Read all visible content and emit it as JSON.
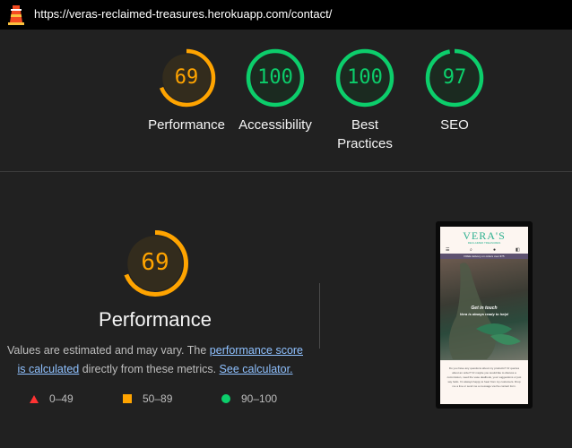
{
  "browser": {
    "url": "https://veras-reclaimed-treasures.herokuapp.com/contact/"
  },
  "summary": {
    "scores": [
      {
        "value": "69",
        "score": 69,
        "label_lines": [
          "Performance"
        ],
        "rating": "average"
      },
      {
        "value": "100",
        "score": 100,
        "label_lines": [
          "Accessibility"
        ],
        "rating": "pass"
      },
      {
        "value": "100",
        "score": 100,
        "label_lines": [
          "Best",
          "Practices"
        ],
        "rating": "pass"
      },
      {
        "value": "97",
        "score": 97,
        "label_lines": [
          "SEO"
        ],
        "rating": "pass"
      }
    ]
  },
  "performance": {
    "value": "69",
    "score": 69,
    "title": "Performance",
    "desc_part1": "Values are estimated and may vary. The ",
    "desc_link1": "performance score is calculated",
    "desc_part2": " directly from these metrics. ",
    "desc_link2": "See calculator."
  },
  "legend": [
    {
      "shape": "triangle",
      "range": "0–49",
      "color": "#ff3333"
    },
    {
      "shape": "square",
      "range": "50–89",
      "color": "#ffa400"
    },
    {
      "shape": "circle",
      "range": "90–100",
      "color": "#0cce6b"
    }
  ],
  "colors": {
    "pass": "#0cce6b",
    "average": "#ffa400",
    "fail": "#ff3333",
    "pass_bg": "#1b2a20",
    "average_bg": "#332c1d"
  },
  "screenshot": {
    "logo": "VERA'S",
    "tagline": "RECLAIMED TREASURES",
    "banner": "FREE delivery on orders over €75",
    "hero_title": "Get in touch",
    "hero_subtitle": "Vera is always ready to help!",
    "body_text": "Do you have any questions about my products? Or queries about an order? Or maybe you would like to discuss a commission, need the vase dealbook, your suggestions or just say hello. I'm always happy to hear from my customers. Drop me a line or send me a message via the contact form."
  }
}
